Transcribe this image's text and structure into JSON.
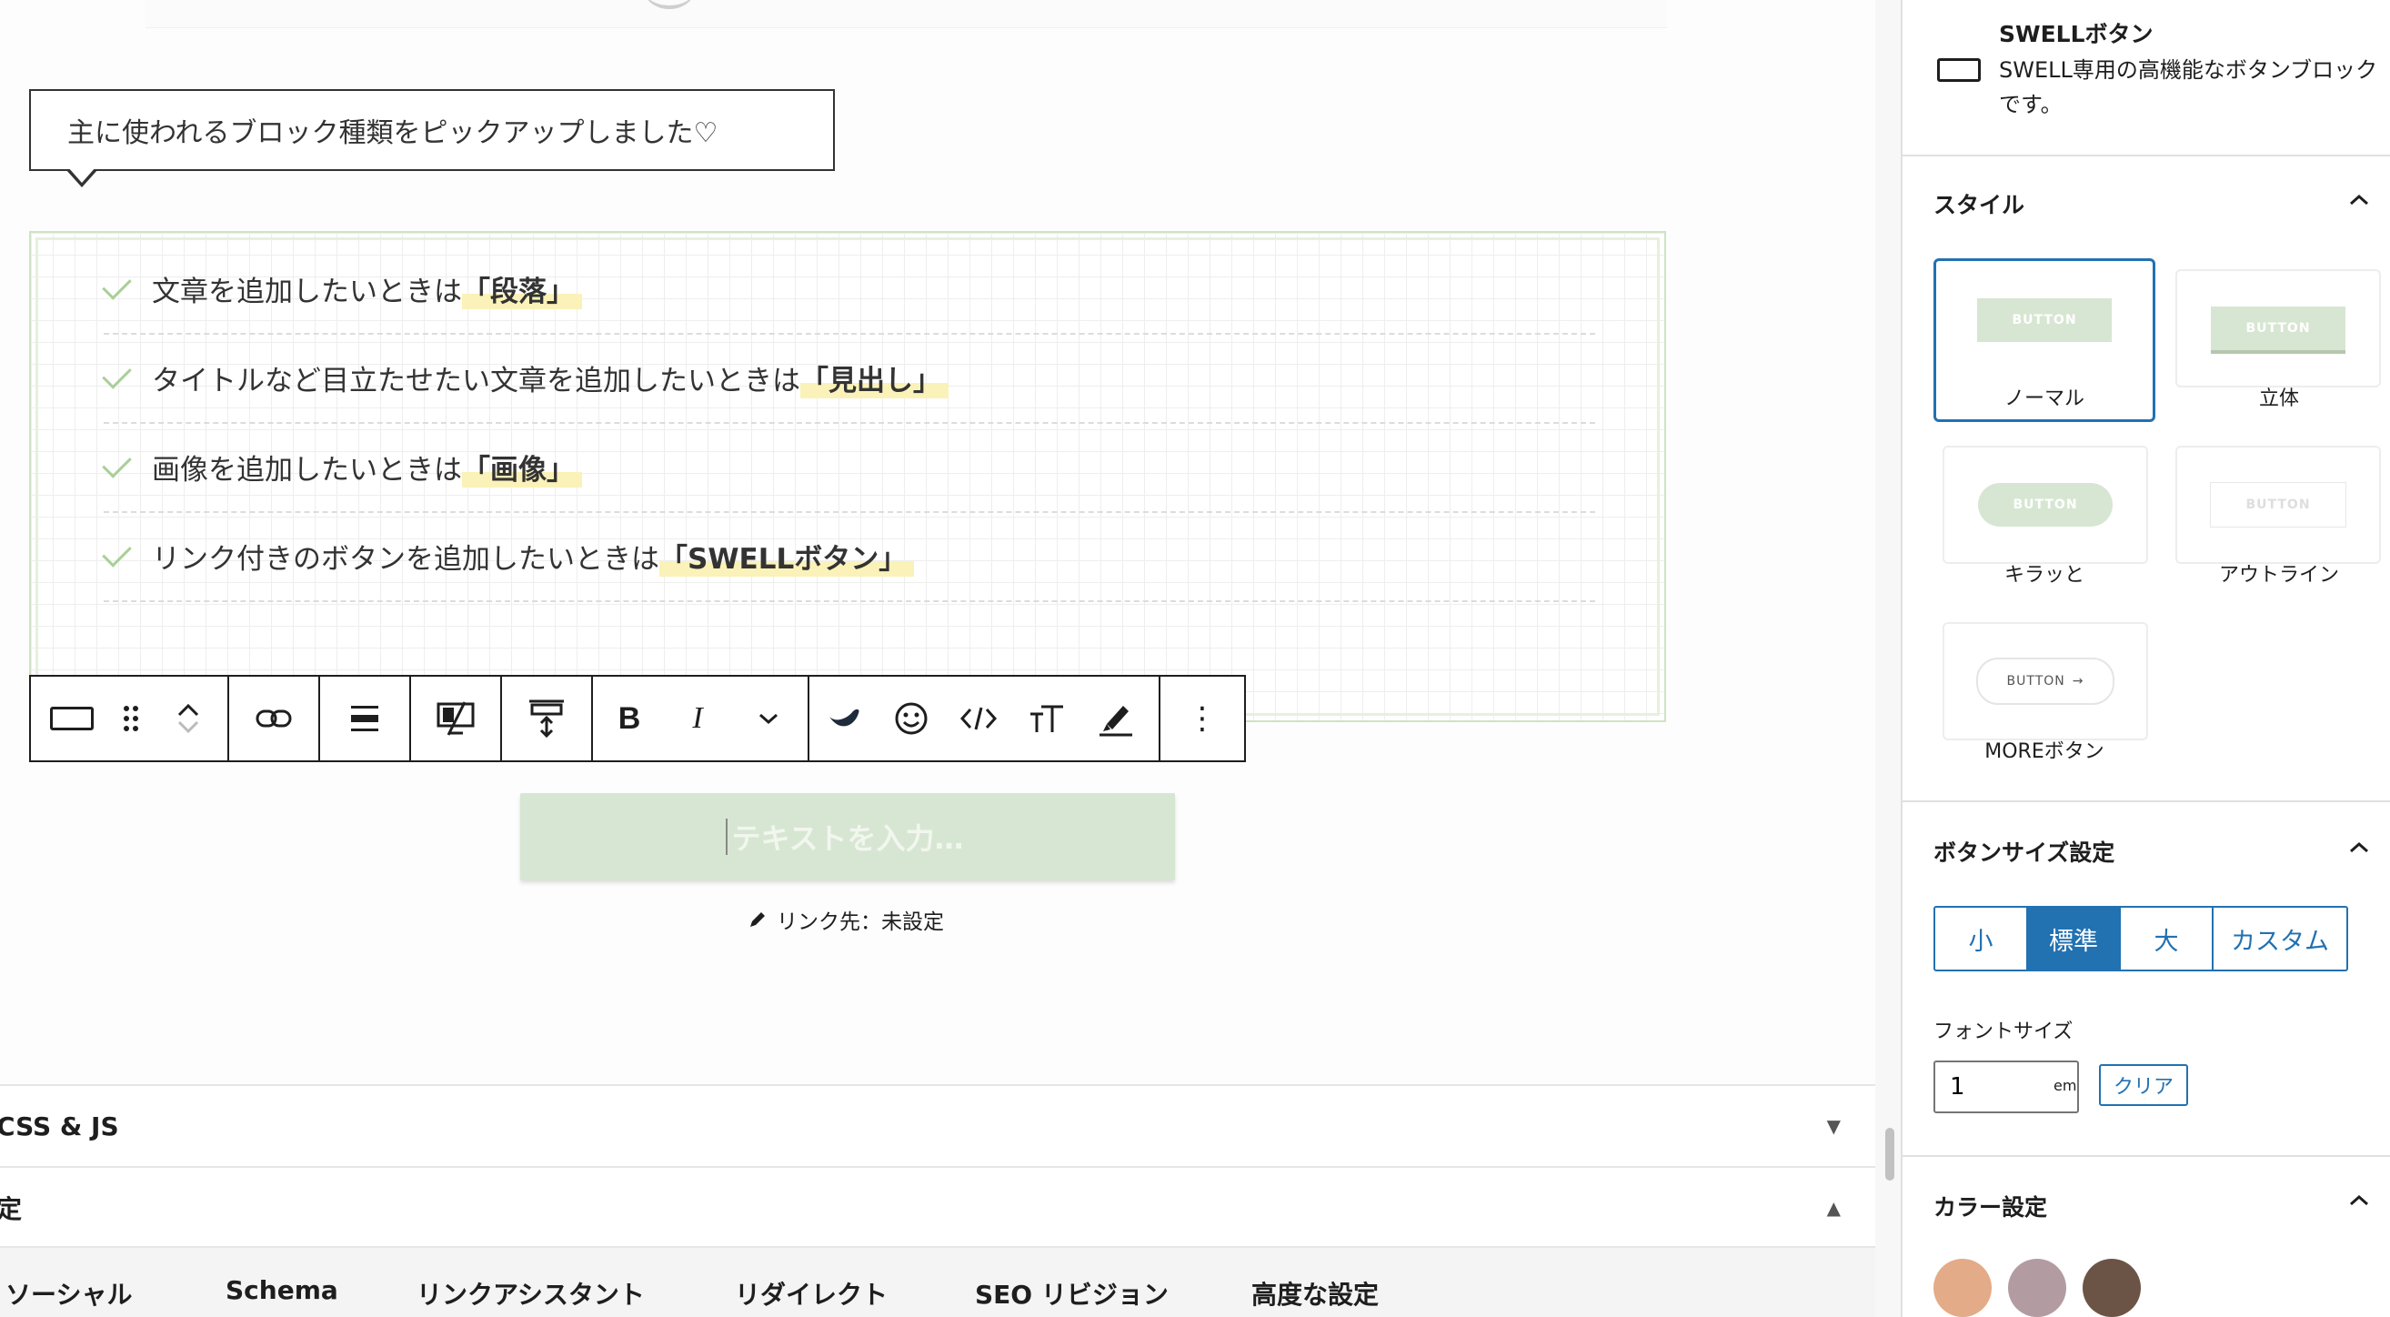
{
  "caption": {
    "text": "主に使われるブロック種類をピックアップしました♡"
  },
  "checklist": [
    {
      "prefix": "文章を追加したいときは",
      "highlight": "「段落」"
    },
    {
      "prefix": "タイトルなど目立たせたい文章を追加したいときは",
      "highlight": "「見出し」"
    },
    {
      "prefix": "画像を追加したいときは",
      "highlight": "「画像」"
    },
    {
      "prefix": "リンク付きのボタンを追加したいときは",
      "highlight": "「SWELLボタン」"
    }
  ],
  "toolbar": {
    "bold": "B",
    "italic": "I",
    "more_label": "⋮"
  },
  "button_block": {
    "placeholder": "テキストを入力…",
    "link_setting": "リンク先：未設定"
  },
  "meta_boxes": {
    "css_js": "CSS & JS",
    "settings_partial": "定"
  },
  "bottom_tabs": [
    "ソーシャル",
    "Schema",
    "リンクアシスタント",
    "リダイレクト",
    "SEO リビジョン",
    "高度な設定"
  ],
  "sidebar": {
    "block_name": "SWELLボタン",
    "block_description": "SWELL専用の高機能なボタンブロックです。",
    "style_panel": {
      "title": "スタイル",
      "preview_text": "BUTTON",
      "more_arrow": "→",
      "options": [
        {
          "label": "ノーマル",
          "selected": true
        },
        {
          "label": "立体",
          "selected": false
        },
        {
          "label": "キラッと",
          "selected": false
        },
        {
          "label": "アウトライン",
          "selected": false
        },
        {
          "label": "MOREボタン",
          "selected": false
        }
      ]
    },
    "size_panel": {
      "title": "ボタンサイズ設定",
      "options": [
        "小",
        "標準",
        "大",
        "カスタム"
      ],
      "selected": "標準",
      "font_size_label": "フォントサイズ",
      "font_size_value": "1",
      "font_size_unit": "em",
      "clear_label": "クリア"
    },
    "color_panel": {
      "title": "カラー設定",
      "swatches": [
        "#e4ab88",
        "#b29ca2",
        "#6b5445"
      ]
    }
  },
  "colors": {
    "accent": "#2271b1",
    "button_green": "#d7e6d2",
    "check_green": "#a9cf98",
    "highlight_yellow": "#fbf2b9"
  }
}
